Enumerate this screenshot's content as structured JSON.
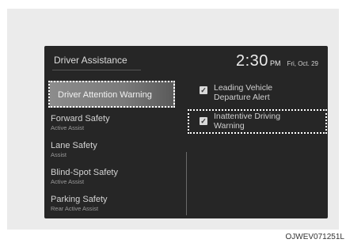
{
  "header": {
    "title": "Driver Assistance",
    "time": "2:30",
    "ampm": "PM",
    "date": "Fri, Oct. 29"
  },
  "menu": {
    "items": [
      {
        "label": "Driver Attention Warning",
        "sub": ""
      },
      {
        "label": "Forward Safety",
        "sub": "Active Assist"
      },
      {
        "label": "Lane Safety",
        "sub": "Assist"
      },
      {
        "label": "Blind-Spot Safety",
        "sub": "Active Assist"
      },
      {
        "label": "Parking Safety",
        "sub": "Rear Active Assist"
      }
    ]
  },
  "options": [
    {
      "label_line1": "Leading Vehicle",
      "label_line2": "Departure Alert",
      "checked": true
    },
    {
      "label_line1": "Inattentive Driving",
      "label_line2": "Warning",
      "checked": true
    }
  ],
  "caption": "OJWEV071251L",
  "colors": {
    "screen_bg": "#262626",
    "selection_bg": "#8c8c8c",
    "frame_bg": "#ebebeb"
  }
}
